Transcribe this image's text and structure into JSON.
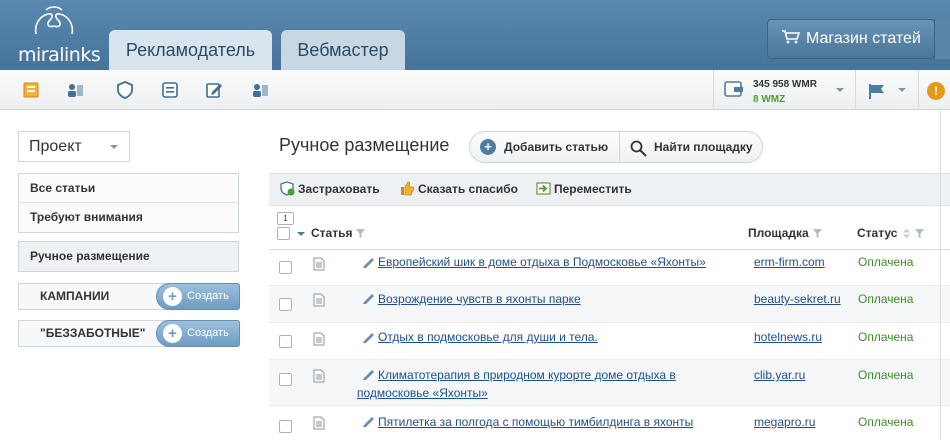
{
  "header": {
    "logo_text": "miralinks",
    "tabs": [
      {
        "label": "Рекламодатель"
      },
      {
        "label": "Вебмастер"
      }
    ],
    "shop_button": "Магазин статей"
  },
  "toolbar": {
    "icons": [
      "articles-icon",
      "users-icon",
      "shield-icon",
      "list-icon",
      "edit-icon",
      "users-card-icon"
    ],
    "balance_wmr": "345 958 WMR",
    "balance_wmz": "8 WMZ"
  },
  "sidebar": {
    "project_select": "Проект",
    "items": [
      {
        "label": "Все статьи"
      },
      {
        "label": "Требуют внимания"
      }
    ],
    "active_item": "Ручное размещение",
    "groups": [
      {
        "label": "КАМПАНИИ",
        "button": "Создать"
      },
      {
        "label": "\"БЕЗЗАБОТНЫЕ\"",
        "button": "Создать"
      }
    ]
  },
  "main": {
    "title": "Ручное размещение",
    "add_article": "Добавить статью",
    "find_site": "Найти площадку",
    "actions": [
      {
        "label": "Застраховать"
      },
      {
        "label": "Сказать спасибо"
      },
      {
        "label": "Переместить"
      }
    ],
    "table": {
      "selected_count": "1",
      "columns": [
        "Статья",
        "Площадка",
        "Статус"
      ],
      "rows": [
        {
          "title": "Европейский шик в доме отдыха в Подмосковье «Яхонты»",
          "site": "erm-firm.com",
          "status": "Оплачена"
        },
        {
          "title": "Возрождение чувств в яхонты парке",
          "site": "beauty-sekret.ru",
          "status": "Оплачена"
        },
        {
          "title": "Отдых в подмосковье для души и тела.",
          "site": "hotelnews.ru",
          "status": "Оплачена"
        },
        {
          "title": "Климатотерапия в природном курорте доме отдыха в подмосковье «Яхонты»",
          "site": "clib.yar.ru",
          "status": "Оплачена"
        },
        {
          "title": "Пятилетка за полгода с помощью тимбилдинга в яхонты",
          "site": "megapro.ru",
          "status": "Оплачена"
        }
      ]
    }
  },
  "colors": {
    "header_bg": "#4f7da3",
    "link": "#1f4f8c",
    "status_paid": "#3d8b2a"
  }
}
